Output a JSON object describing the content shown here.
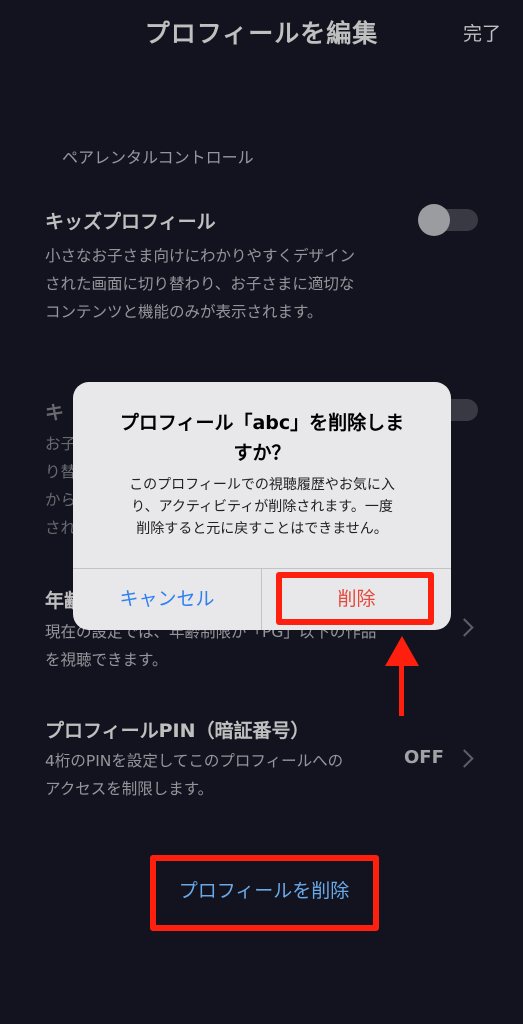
{
  "header": {
    "title": "プロフィールを編集",
    "done_label": "完了"
  },
  "parental": {
    "section_label": "ペアレンタルコントロール",
    "kids_profile": {
      "title": "キッズプロフィール",
      "desc_lines": [
        "小さなお子さま向けにわかりやすくデザイン",
        "された画面に切り替わり、お子さまに適切な",
        "コンテンツと機能のみが表示されます。"
      ],
      "toggle_state": "off"
    },
    "second_row": {
      "title": "キ",
      "desc_lines": [
        "お子",
        "り替",
        "から",
        "され"
      ],
      "toggle_state": "off"
    },
    "age_limit": {
      "title": "年齢",
      "desc_lines": [
        "現在の設定では、年齢制限が「PG」以下の作品",
        "を視聴できます。"
      ]
    },
    "profile_pin": {
      "title": "プロフィールPIN（暗証番号）",
      "desc_lines": [
        "4桁のPINを設定してこのプロフィールへの",
        "アクセスを制限します。"
      ],
      "value": "OFF"
    }
  },
  "dialog": {
    "title_lines": [
      "プロフィール「abc」を削除しま",
      "すか？"
    ],
    "message_lines": [
      "このプロフィールでの視聴履歴やお気に入",
      "り、アクティビティが削除されます。一度",
      "削除すると元に戻すことはできません。"
    ],
    "cancel_label": "キャンセル",
    "delete_label": "削除"
  },
  "delete_profile_label": "プロフィールを削除",
  "colors": {
    "background": "#181a28",
    "highlight": "#ff1f0e",
    "link": "#6aa9e8",
    "ios_blue": "#2f7ff1",
    "destructive": "#e5483a"
  }
}
